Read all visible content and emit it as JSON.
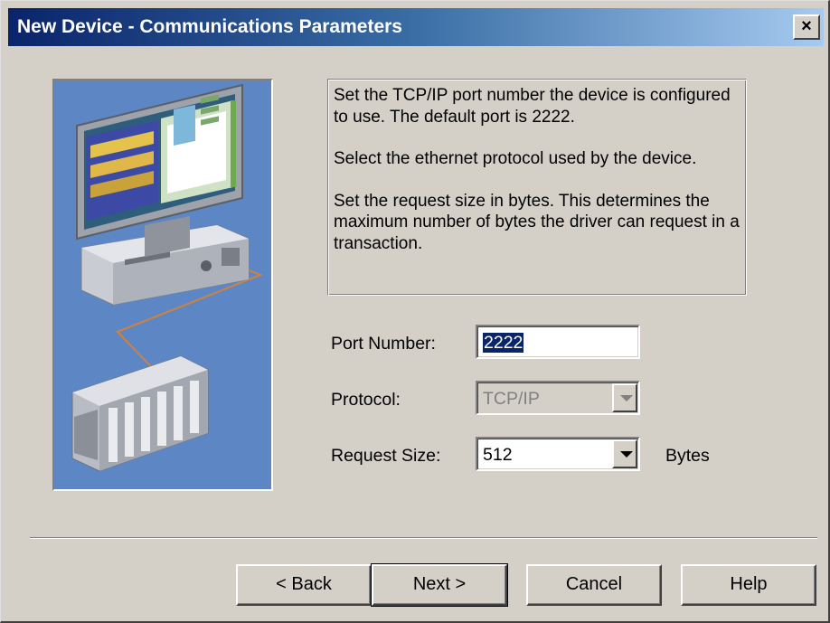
{
  "window": {
    "title": "New Device - Communications Parameters",
    "close_label": "×"
  },
  "description": {
    "paragraph1": "Set the TCP/IP port number the device is configured to use.  The  default port is 2222.",
    "paragraph2": "Select the ethernet protocol used by the device.",
    "paragraph3": "Set the request size in bytes.  This determines the maximum number of bytes the driver can request in a transaction."
  },
  "form": {
    "port_label": "Port Number:",
    "port_value": "2222",
    "protocol_label": "Protocol:",
    "protocol_value": "TCP/IP",
    "request_size_label": "Request Size:",
    "request_size_value": "512",
    "request_size_unit": "Bytes"
  },
  "buttons": {
    "back_label": "< Back",
    "next_label": "Next >",
    "cancel_label": "Cancel",
    "help_label": "Help"
  },
  "icons": {
    "close": "close-icon",
    "dropdown": "chevron-down-icon",
    "illustration": "computer-and-plc-illustration"
  },
  "colors": {
    "titlebar_start": "#0a246a",
    "titlebar_end": "#a6caf0",
    "dialog_bg": "#d4d0c8",
    "selection": "#0a246a",
    "art_bg": "#5d87c4"
  }
}
